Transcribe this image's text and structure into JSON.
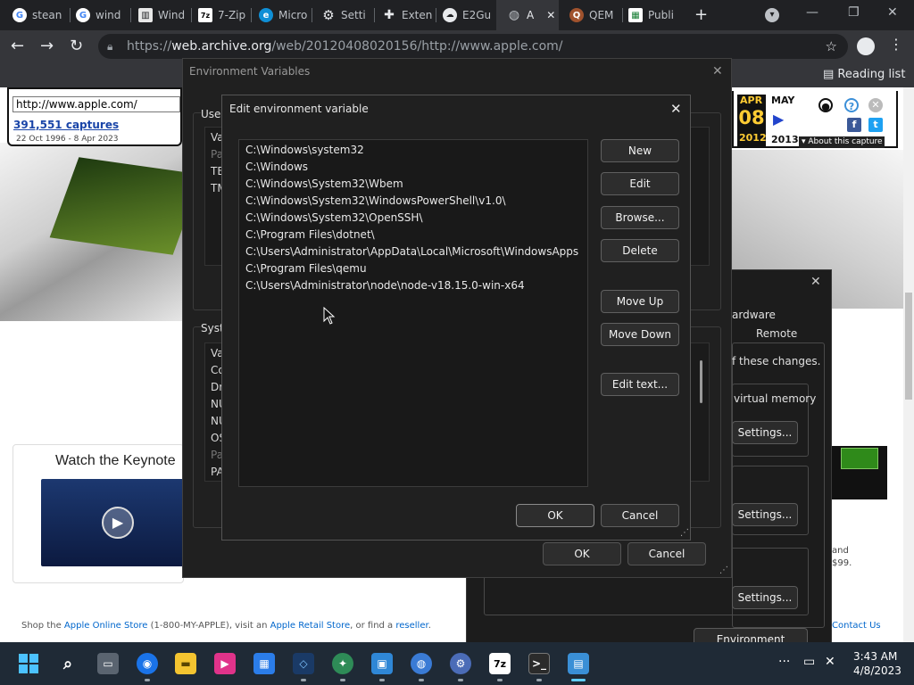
{
  "browser": {
    "tabs": [
      {
        "label": "stean",
        "icon": "google-icon"
      },
      {
        "label": "wind",
        "icon": "google-icon"
      },
      {
        "label": "Wind",
        "icon": "columns-icon"
      },
      {
        "label": "7-Zip",
        "icon": "7zip-icon"
      },
      {
        "label": "Micro",
        "icon": "edge-icon"
      },
      {
        "label": "Setti",
        "icon": "gear-icon"
      },
      {
        "label": "Exten",
        "icon": "puzzle-icon"
      },
      {
        "label": "E2Gu",
        "icon": "cloud-icon"
      },
      {
        "label": "A",
        "icon": "globe-icon",
        "active": true
      },
      {
        "label": "QEM",
        "icon": "qemu-icon"
      },
      {
        "label": "Publi",
        "icon": "grid-icon"
      }
    ],
    "url_scheme": "https://",
    "url_host": "web.archive.org",
    "url_path": "/web/20120408020156/http://www.apple.com/",
    "reading_list": "Reading list"
  },
  "wayback": {
    "url_field": "http://www.apple.com/",
    "captures": "391,551 captures",
    "date_range": "22 Oct 1996 - 8 Apr 2023",
    "month_prev": "APR",
    "day": "08",
    "year_prev": "2012",
    "month_next": "MAY",
    "year_next": "2013",
    "about": "About this capture"
  },
  "apple_page": {
    "keynote": "Watch the Keynote",
    "footer_prefix": "Shop the ",
    "footer_store": "Apple Online Store",
    "footer_mid": " (1-800-MY-APPLE), visit an ",
    "footer_retail": "Apple Retail Store",
    "footer_end": ", or find a ",
    "footer_reseller": "reseller",
    "footer_dot": ".",
    "contact": "Contact Us",
    "side_text_1": "and",
    "side_text_2": "$99."
  },
  "system_properties": {
    "tab_hardware": "ardware",
    "tab_remote": "Remote",
    "note": "f these changes.",
    "virtual_memory": "virtual memory",
    "settings_1": "Settings...",
    "settings_2": "Settings...",
    "settings_3": "Settings...",
    "env_button": "Environment Variables..."
  },
  "env_dialog": {
    "title": "Environment Variables",
    "user_group": "User",
    "user_col": "Va",
    "user_rows": [
      "Pa",
      "TE",
      "TM"
    ],
    "system_group": "Syst",
    "system_col": "Va",
    "system_rows": [
      "Co",
      "Dr",
      "NU",
      "NU",
      "OS",
      "Pa",
      "PA"
    ],
    "ok": "OK",
    "cancel": "Cancel"
  },
  "edit_dialog": {
    "title": "Edit environment variable",
    "paths": [
      "C:\\Windows\\system32",
      "C:\\Windows",
      "C:\\Windows\\System32\\Wbem",
      "C:\\Windows\\System32\\WindowsPowerShell\\v1.0\\",
      "C:\\Windows\\System32\\OpenSSH\\",
      "C:\\Program Files\\dotnet\\",
      "C:\\Users\\Administrator\\AppData\\Local\\Microsoft\\WindowsApps",
      "C:\\Program Files\\qemu",
      "C:\\Users\\Administrator\\node\\node-v18.15.0-win-x64"
    ],
    "buttons": {
      "new": "New",
      "edit": "Edit",
      "browse": "Browse...",
      "delete": "Delete",
      "move_up": "Move Up",
      "move_down": "Move Down",
      "edit_text": "Edit text..."
    },
    "ok": "OK",
    "cancel": "Cancel"
  },
  "taskbar": {
    "icons": [
      "start-icon",
      "search-icon",
      "task-view-icon",
      "chrome-icon",
      "file-explorer-icon",
      "media-player-icon",
      "store-icon",
      "virtualbox-icon",
      "network-icon",
      "remote-desktop-icon",
      "globe-icon",
      "settings-icon",
      "7zip-icon",
      "terminal-icon",
      "system-properties-icon"
    ],
    "time": "3:43 AM",
    "date": "4/8/2023"
  },
  "colors": {
    "dialog_bg": "#202020",
    "taskbar_bg": "#1f2a36",
    "accent": "#60cdff",
    "link": "#0066cc"
  }
}
